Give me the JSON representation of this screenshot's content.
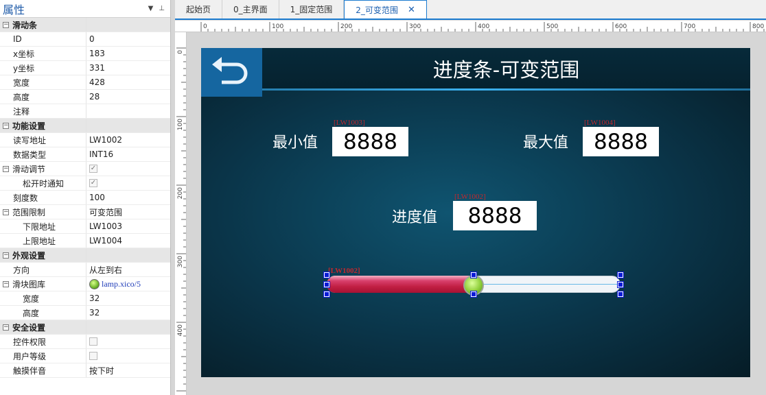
{
  "properties": {
    "title": "属性",
    "pin_icon": "pin-icon",
    "rows": [
      {
        "type": "group",
        "name": "滑动条"
      },
      {
        "type": "prop",
        "level": 1,
        "name": "ID",
        "value": "0"
      },
      {
        "type": "prop",
        "level": 1,
        "name": "x坐标",
        "value": "183"
      },
      {
        "type": "prop",
        "level": 1,
        "name": "y坐标",
        "value": "331"
      },
      {
        "type": "prop",
        "level": 1,
        "name": "宽度",
        "value": "428"
      },
      {
        "type": "prop",
        "level": 1,
        "name": "高度",
        "value": "28"
      },
      {
        "type": "prop",
        "level": 1,
        "name": "注释",
        "value": ""
      },
      {
        "type": "group",
        "name": "功能设置"
      },
      {
        "type": "prop",
        "level": 1,
        "name": "读写地址",
        "value": "LW1002"
      },
      {
        "type": "prop",
        "level": 1,
        "name": "数据类型",
        "value": "INT16"
      },
      {
        "type": "subgroup",
        "level": 0,
        "name": "滑动调节",
        "check": true
      },
      {
        "type": "prop",
        "level": 2,
        "name": "松开时通知",
        "check": true
      },
      {
        "type": "prop",
        "level": 1,
        "name": "刻度数",
        "value": "100"
      },
      {
        "type": "subgroup",
        "level": 0,
        "name": "范围限制",
        "value": "可变范围"
      },
      {
        "type": "prop",
        "level": 2,
        "name": "下限地址",
        "value": "LW1003"
      },
      {
        "type": "prop",
        "level": 2,
        "name": "上限地址",
        "value": "LW1004"
      },
      {
        "type": "group",
        "name": "外观设置"
      },
      {
        "type": "prop",
        "level": 1,
        "name": "方向",
        "value": "从左到右"
      },
      {
        "type": "subgroup",
        "level": 0,
        "name": "滑块图库",
        "lamp": "lamp.xico/5"
      },
      {
        "type": "prop",
        "level": 2,
        "name": "宽度",
        "value": "32"
      },
      {
        "type": "prop",
        "level": 2,
        "name": "高度",
        "value": "32"
      },
      {
        "type": "group",
        "name": "安全设置"
      },
      {
        "type": "prop",
        "level": 1,
        "name": "控件权限",
        "check": false
      },
      {
        "type": "prop",
        "level": 1,
        "name": "用户等级",
        "check": false
      },
      {
        "type": "prop",
        "level": 1,
        "name": "触摸伴音",
        "value": "按下时"
      }
    ]
  },
  "tabs": [
    {
      "label": "起始页",
      "active": false
    },
    {
      "label": "0_主界面",
      "active": false
    },
    {
      "label": "1_固定范围",
      "active": false
    },
    {
      "label": "2_可变范围",
      "active": true
    }
  ],
  "ruler": {
    "h_labels": [
      "0",
      "100",
      "200",
      "300",
      "400",
      "500",
      "600",
      "700",
      "800"
    ],
    "v_labels": [
      "0",
      "100",
      "200",
      "300",
      "400"
    ]
  },
  "screen": {
    "title": "进度条-可变范围",
    "back_icon": "return-arrow-icon",
    "min_label": "最小值",
    "min_value": "8888",
    "min_tag": "[LW1003]",
    "max_label": "最大值",
    "max_value": "8888",
    "max_tag": "[LW1004]",
    "progress_label": "进度值",
    "progress_value": "8888",
    "progress_tag": "[LW1002]",
    "slider_tag": "[LW1002]",
    "slider_level": 0.5
  },
  "colors": {
    "accent": "#1b7bd0",
    "fill": "#c01e42",
    "screen_bg": "#0a3448"
  }
}
